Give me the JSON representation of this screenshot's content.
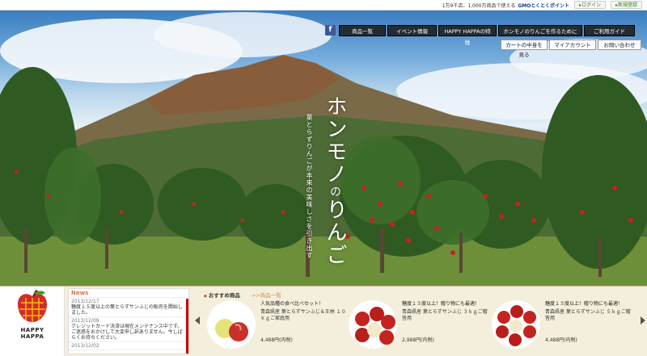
{
  "topbar": {
    "promo_text": "1万9千店、1,000万商品で使える",
    "gmo_label": "GMOとくとくポイント",
    "login_label": "▸ログイン",
    "register_label": "▸新規登録"
  },
  "nav": {
    "facebook_label": "f",
    "items": [
      "商品一覧",
      "イベント情報",
      "HAPPY HAPPAの特徴",
      "ホンモノのりんごを作るために",
      "ご利用ガイド"
    ],
    "sub_items": [
      "カートの中身を見る",
      "マイアカウント",
      "お問い合わせ"
    ]
  },
  "hero": {
    "headline_a": "ホンモノ",
    "headline_b": "の",
    "headline_c": "りんご",
    "subcopy": "葉とらずりんごが本来の美味しさを引き出す"
  },
  "slider": {
    "active_index": 4,
    "count": 5
  },
  "logo": {
    "brand_line1": "HAPPY",
    "brand_line2": "HAPPA"
  },
  "news": {
    "title": "News",
    "entries": [
      {
        "date": "2013/12/17",
        "text": "糖度１５度以上の葉とらずサンふじの販売を開始しました。"
      },
      {
        "date": "2013/12/09",
        "text": "クレジットカード決済は現在メンテナンス中です。ご迷惑をおかけして大変申し訳ありません。今しばらくお待ちください。"
      },
      {
        "date": "2013/12/02",
        "text": ""
      }
    ]
  },
  "recommend": {
    "heading": "おすすめ商品",
    "link": ">>商品一覧",
    "cards": [
      {
        "head": "人気品種の食べ比べセット！",
        "desc": "青森県産 葉とらずサンふじ＆王林 １０ｋｇご家庭用",
        "price": "4,488円(内税)"
      },
      {
        "head": "糖度１３度以上！贈り物にも最適！",
        "desc": "青森県産 葉とらずサンふじ ３ｋｇご贈答用",
        "price": "2,988円(内税)"
      },
      {
        "head": "糖度１３度以上！贈り物にも最適！",
        "desc": "青森県産 葉とらずサンふじ ５ｋｇご贈答用",
        "price": "4,488円(内税)"
      }
    ]
  }
}
